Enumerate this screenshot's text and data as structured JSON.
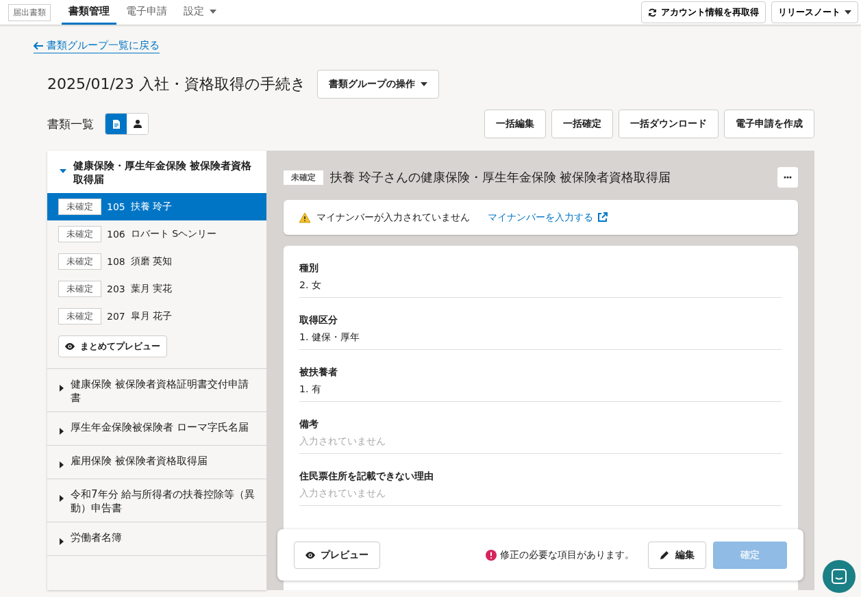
{
  "nav": {
    "brand": "届出書類",
    "tabs": [
      {
        "label": "書類管理",
        "selected": true,
        "dropdown": false
      },
      {
        "label": "電子申請",
        "selected": false,
        "dropdown": false
      },
      {
        "label": "設定",
        "selected": false,
        "dropdown": true
      }
    ],
    "buttons": [
      {
        "label": "アカウント情報を再取得",
        "kind": "refresh"
      },
      {
        "label": "リリースノート",
        "kind": "dropdown"
      }
    ]
  },
  "back_link": "書類グループ一覧に戻る",
  "title": "2025/01/23 入社・資格取得の手続き",
  "group_action": "書類グループの操作",
  "list_heading": "書類一覧",
  "view_toggle": [
    {
      "kind": "document",
      "selected": true
    },
    {
      "kind": "person",
      "selected": false
    }
  ],
  "bulk_buttons": [
    "一括編集",
    "一括確定",
    "一括ダウンロード",
    "電子申請を作成"
  ],
  "groups": [
    {
      "title": "健康保険・厚生年金保険 被保険者資格取得届",
      "expanded": true,
      "items": [
        {
          "status": "未確定",
          "number": "105",
          "name": "扶養 玲子",
          "selected": true
        },
        {
          "status": "未確定",
          "number": "106",
          "name": "ロバート Sヘンリー",
          "selected": false
        },
        {
          "status": "未確定",
          "number": "108",
          "name": "須磨 英知",
          "selected": false
        },
        {
          "status": "未確定",
          "number": "203",
          "name": "葉月 実花",
          "selected": false
        },
        {
          "status": "未確定",
          "number": "207",
          "name": "皐月 花子",
          "selected": false
        }
      ],
      "preview_button": "まとめてプレビュー"
    },
    {
      "title": "健康保険 被保険者資格証明書交付申請書",
      "expanded": false
    },
    {
      "title": "厚生年金保険被保険者 ローマ字氏名届",
      "expanded": false
    },
    {
      "title": "雇用保険 被保険者資格取得届",
      "expanded": false
    },
    {
      "title": "令和7年分 給与所得者の扶養控除等（異動）申告書",
      "expanded": false
    },
    {
      "title": "労働者名簿",
      "expanded": false
    }
  ],
  "detail": {
    "status": "未確定",
    "title": "扶養 玲子さんの健康保険・厚生年金保険 被保険者資格取得届",
    "alert": {
      "message": "マイナンバーが入力されていません",
      "link": "マイナンバーを入力する"
    },
    "fields": [
      {
        "label": "種別",
        "value": "2. 女",
        "empty": false
      },
      {
        "label": "取得区分",
        "value": "1. 健保・厚年",
        "empty": false
      },
      {
        "label": "被扶養者",
        "value": "1. 有",
        "empty": false
      },
      {
        "label": "備考",
        "value": "入力されていません",
        "empty": true
      },
      {
        "label": "住民票住所を記載できない理由",
        "value": "入力されていません",
        "empty": true
      }
    ]
  },
  "footer": {
    "preview": "プレビュー",
    "error": "修正の必要な項目があります。",
    "edit": "編集",
    "confirm": {
      "label": "確定",
      "disabled": true
    }
  }
}
